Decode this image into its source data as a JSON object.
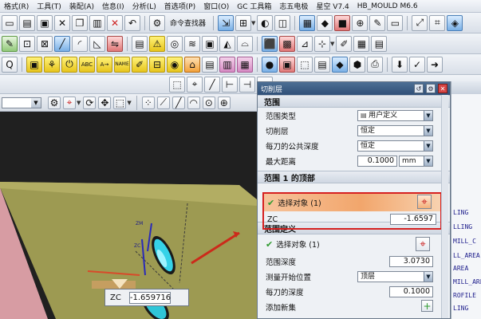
{
  "menubar": {
    "items": [
      "格式(R)",
      "工具(T)",
      "装配(A)",
      "信息(I)",
      "分析(L)",
      "首选项(P)",
      "窗口(O)",
      "GC 工具箱",
      "志五电极",
      "星空 V7.4",
      "HB_MOULD M6.6"
    ]
  },
  "toolbar1": {
    "cmd_finder": "命令查找器"
  },
  "toolbar3": {
    "name_label": "NAME"
  },
  "dialog": {
    "title": "切削层",
    "range_group": {
      "header": "范围",
      "range_type_label": "范围类型",
      "range_type_value": "用户定义",
      "cut_layer_label": "切削层",
      "cut_layer_value": "恒定",
      "common_depth_label": "每刀的公共深度",
      "common_depth_value": "恒定",
      "max_distance_label": "最大距离",
      "max_distance_value": "0.1000",
      "max_distance_unit": "mm"
    },
    "range1_top_group": {
      "header": "范围 1 的顶部",
      "select_object_label": "选择对象 (1)",
      "zc_label": "ZC",
      "zc_value": "-1.6597"
    },
    "range_def_group": {
      "header": "范围定义",
      "select_object_label": "选择对象 (1)",
      "range_depth_label": "范围深度",
      "range_depth_value": "3.0730",
      "measure_from_label": "测量开始位置",
      "measure_from_value": "顶层",
      "per_cut_depth_label": "每刀的深度",
      "per_cut_depth_value": "0.1000",
      "add_set_label": "添加新集"
    }
  },
  "viewport": {
    "zc_box_label": "ZC",
    "zc_box_value": "-1.659716",
    "axis_zm": "ZM",
    "axis_zc": "ZC"
  },
  "right_panel": {
    "items": [
      "LING",
      "LLING",
      "MILL_C",
      "LL_AREA",
      "AREA",
      "MILL_AREA",
      "ROFILE",
      "LING"
    ]
  },
  "colors": {
    "title_bar": "#3a5a82",
    "highlight_border": "#d62020",
    "selected_row": "#f2a66c",
    "check": "#2f9a2f"
  }
}
